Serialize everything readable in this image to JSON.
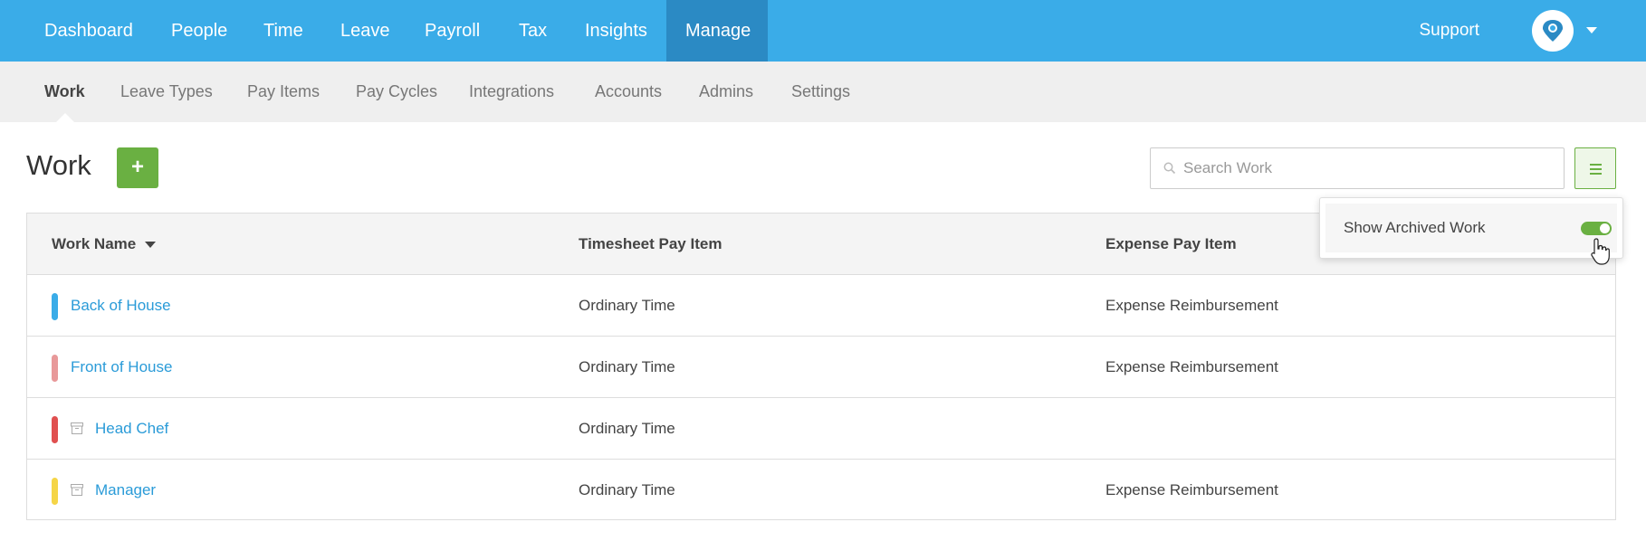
{
  "topnav": {
    "items": [
      {
        "label": "Dashboard"
      },
      {
        "label": "People"
      },
      {
        "label": "Time"
      },
      {
        "label": "Leave"
      },
      {
        "label": "Payroll"
      },
      {
        "label": "Tax"
      },
      {
        "label": "Insights"
      },
      {
        "label": "Manage",
        "active": true
      }
    ],
    "support": "Support",
    "avatar_icon": "company-logo-icon"
  },
  "subnav": {
    "items": [
      {
        "label": "Work",
        "active": true
      },
      {
        "label": "Leave Types"
      },
      {
        "label": "Pay Items"
      },
      {
        "label": "Pay Cycles"
      },
      {
        "label": "Integrations"
      },
      {
        "label": "Accounts"
      },
      {
        "label": "Admins"
      },
      {
        "label": "Settings"
      }
    ]
  },
  "page": {
    "title": "Work",
    "add_label": "+",
    "search_placeholder": "Search Work",
    "search_value": ""
  },
  "table": {
    "headers": {
      "name": "Work Name",
      "timesheet": "Timesheet Pay Item",
      "expense": "Expense Pay Item"
    },
    "rows": [
      {
        "color": "#3aace8",
        "archived": false,
        "name": "Back of House",
        "timesheet": "Ordinary Time",
        "expense": "Expense Reimbursement"
      },
      {
        "color": "#e8999a",
        "archived": false,
        "name": "Front of House",
        "timesheet": "Ordinary Time",
        "expense": "Expense Reimbursement"
      },
      {
        "color": "#e05050",
        "archived": true,
        "name": "Head Chef",
        "timesheet": "Ordinary Time",
        "expense": ""
      },
      {
        "color": "#f5d547",
        "archived": true,
        "name": "Manager",
        "timesheet": "Ordinary Time",
        "expense": "Expense Reimbursement"
      }
    ]
  },
  "dropdown": {
    "label": "Show Archived Work",
    "toggle_on": true
  },
  "colors": {
    "primary": "#3aace8",
    "primary_active": "#2b8ac4",
    "accent_green": "#6ab042",
    "link": "#2a9bd8"
  }
}
